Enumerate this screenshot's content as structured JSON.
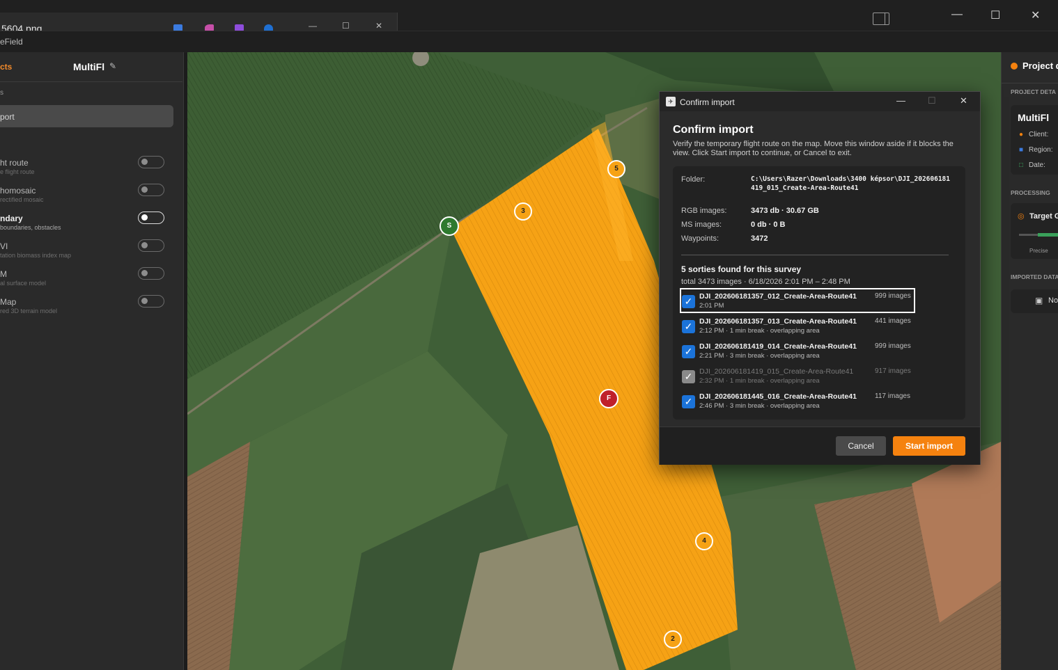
{
  "os": {
    "bg_window_title": "5604.png",
    "bg_window_controls": [
      "—",
      "☐",
      "✕"
    ],
    "window_controls": [
      "—",
      "☐",
      "✕"
    ]
  },
  "app": {
    "title": "eField"
  },
  "left": {
    "tab_projects": "cts",
    "project_name": "MultiFl",
    "section": "s",
    "import_label": "port",
    "layers": [
      {
        "title": "ht route",
        "sub": "e flight route",
        "on": false
      },
      {
        "title": "homosaic",
        "sub": "rectified mosaic",
        "on": false
      },
      {
        "title": "ndary",
        "sub": "boundaries, obstacles",
        "on": true
      },
      {
        "title": "VI",
        "sub": "tation biomass index map",
        "on": false
      },
      {
        "title": "M",
        "sub": "al surface model",
        "on": false
      },
      {
        "title": "Map",
        "sub": "red 3D terrain model",
        "on": false
      }
    ]
  },
  "map": {
    "markers": [
      {
        "label": "S",
        "kind": "start"
      },
      {
        "label": "F",
        "kind": "finish"
      },
      {
        "label": "5",
        "kind": "sortie"
      },
      {
        "label": "3",
        "kind": "sortie"
      },
      {
        "label": "4",
        "kind": "sortie"
      },
      {
        "label": "2",
        "kind": "sortie"
      }
    ],
    "route_color": "#f6a215"
  },
  "right": {
    "header": "Project d",
    "project_details": "PROJECT DETA",
    "project_name": "MultiFl",
    "client": "Client:",
    "region": "Region:",
    "date": "Date:",
    "processing": "PROCESSING",
    "target": "Target G",
    "precise": "Precise",
    "imported": "IMPORTED DATA",
    "imported_btn": "No"
  },
  "dialog": {
    "window_title": "Confirm import",
    "heading": "Confirm import",
    "description": "Verify the temporary flight route on the map. Move this window aside if it blocks the view. Click Start import to continue, or Cancel to exit.",
    "info": {
      "folder_label": "Folder:",
      "folder_value": "C:\\Users\\Razer\\Downloads\\3400 képsor\\DJI_202606181419_015_Create-Area-Route41",
      "rgb_label": "RGB images:",
      "rgb_value": "3473 db · 30.67 GB",
      "ms_label": "MS images:",
      "ms_value": "0 db · 0 B",
      "waypoints_label": "Waypoints:",
      "waypoints_value": "3472"
    },
    "sorties_title": "5 sorties found for this survey",
    "sorties_subtitle": "total 3473 images · 6/18/2026 2:01 PM – 2:48 PM",
    "sorties": [
      {
        "name": "DJI_202606181357_012_Create-Area-Route41",
        "count": "999 images",
        "meta": "2:01 PM",
        "checked": true
      },
      {
        "name": "DJI_202606181357_013_Create-Area-Route41",
        "count": "441 images",
        "meta": "2:12 PM · 1 min break · overlapping area",
        "checked": true
      },
      {
        "name": "DJI_202606181419_014_Create-Area-Route41",
        "count": "999 images",
        "meta": "2:21 PM · 3 min break · overlapping area",
        "checked": true
      },
      {
        "name": "DJI_202606181419_015_Create-Area-Route41",
        "count": "917 images",
        "meta": "2:32 PM · 1 min break · overlapping area",
        "checked": true
      },
      {
        "name": "DJI_202606181445_016_Create-Area-Route41",
        "count": "117 images",
        "meta": "2:46 PM · 3 min break · overlapping area",
        "checked": true
      }
    ],
    "cancel_label": "Cancel",
    "start_label": "Start import",
    "checkmark": "✓"
  },
  "colors": {
    "accent": "#f5820f",
    "checkbox": "#1b73d9"
  }
}
